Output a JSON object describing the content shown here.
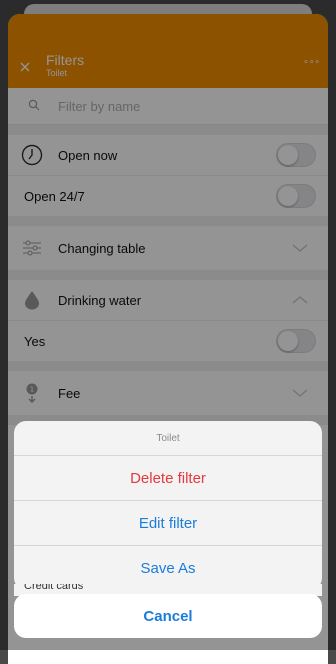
{
  "header": {
    "title": "Filters",
    "subtitle": "Toilet",
    "more": "∘∘∘",
    "background": "#f28d00"
  },
  "search": {
    "placeholder": "Filter by name"
  },
  "filters": {
    "open_now": "Open now",
    "open_247": "Open 24/7",
    "changing_table": "Changing table",
    "drinking_water": "Drinking water",
    "yes": "Yes",
    "fee": "Fee"
  },
  "action_sheet": {
    "title": "Toilet",
    "delete": "Delete filter",
    "edit": "Edit filter",
    "save_as": "Save As",
    "peek_row": "Credit cards",
    "cancel": "Cancel"
  },
  "colors": {
    "accent": "#1a7ddb",
    "destructive": "#e5393c"
  }
}
